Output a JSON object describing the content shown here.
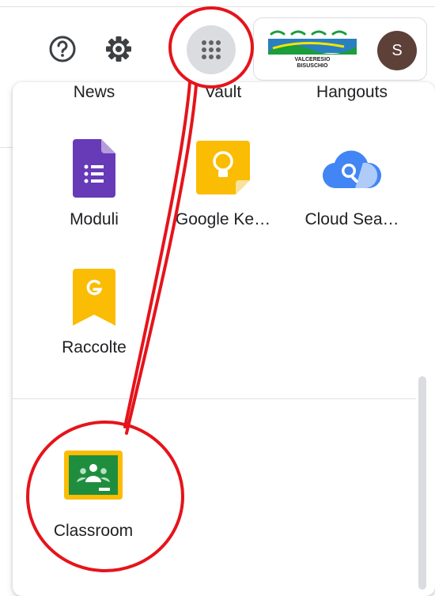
{
  "header": {
    "help_icon": "help-circle-icon",
    "settings_icon": "gear-icon",
    "apps_icon": "apps-grid-icon",
    "org_logo_text": [
      "VALCERESIO",
      "BISUSCHIO"
    ],
    "avatar_initial": "S"
  },
  "app_grid": {
    "row_top": [
      "News",
      "Vault",
      "Hangouts"
    ],
    "apps": [
      {
        "label": "Moduli",
        "icon": "google-forms-icon"
      },
      {
        "label": "Google Ke…",
        "icon": "google-keep-icon"
      },
      {
        "label": "Cloud Sea…",
        "icon": "cloud-search-icon"
      },
      {
        "label": "Raccolte",
        "icon": "google-collections-icon"
      }
    ],
    "more_apps": [
      {
        "label": "Classroom",
        "icon": "google-classroom-icon"
      }
    ]
  },
  "colors": {
    "annotation": "#e5141b",
    "forms": "#673ab7",
    "keep": "#fbbc04",
    "cloud_search": "#4285f4",
    "classroom": "#1e8e3e",
    "avatar": "#5d4037"
  }
}
